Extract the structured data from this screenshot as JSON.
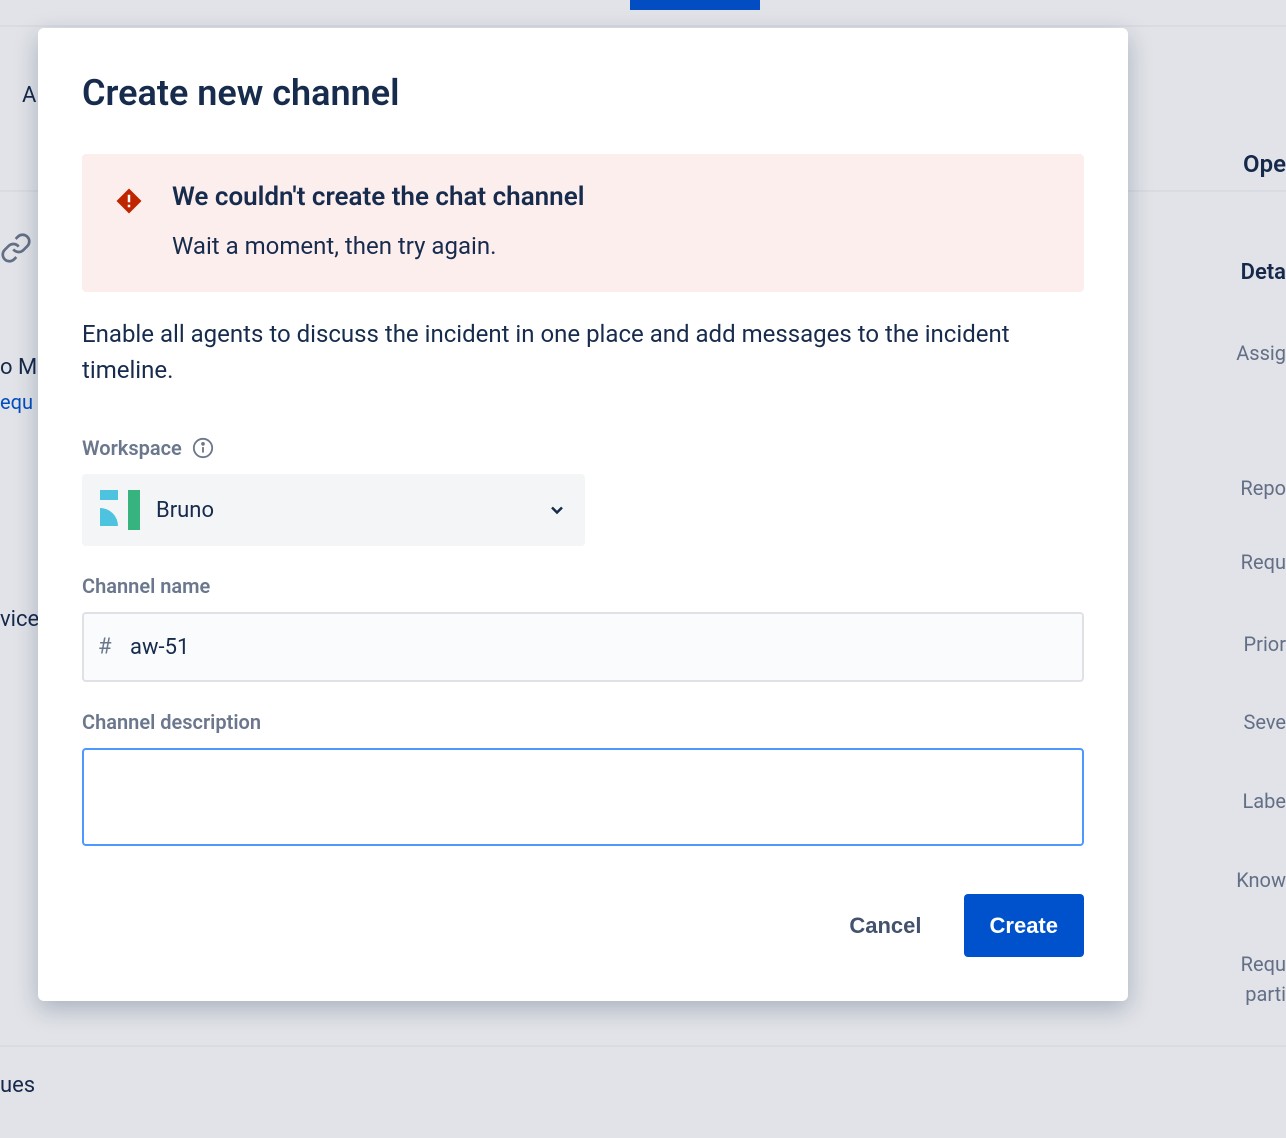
{
  "modal": {
    "title": "Create new channel",
    "error": {
      "title": "We couldn't create the chat channel",
      "message": "Wait a moment, then try again."
    },
    "description": "Enable all agents to discuss the incident in one place and add messages to the incident timeline.",
    "fields": {
      "workspace": {
        "label": "Workspace",
        "selected": "Bruno"
      },
      "channel_name": {
        "label": "Channel name",
        "prefix": "#",
        "value": "aw-51"
      },
      "channel_description": {
        "label": "Channel description",
        "value": ""
      }
    },
    "buttons": {
      "cancel": "Cancel",
      "create": "Create"
    }
  },
  "background": {
    "top_a": "A",
    "link_m": "o M",
    "link_equ": "equ",
    "vice": "vice",
    "ues": "ues",
    "right": {
      "open": "Ope",
      "details": "Deta",
      "assignee": "Assig",
      "reporter": "Repo",
      "request": "Requ",
      "priority": "Prior",
      "severity": "Seve",
      "labels": "Labe",
      "knowledge": "Know",
      "request2": "Requ",
      "participants": "parti"
    }
  }
}
